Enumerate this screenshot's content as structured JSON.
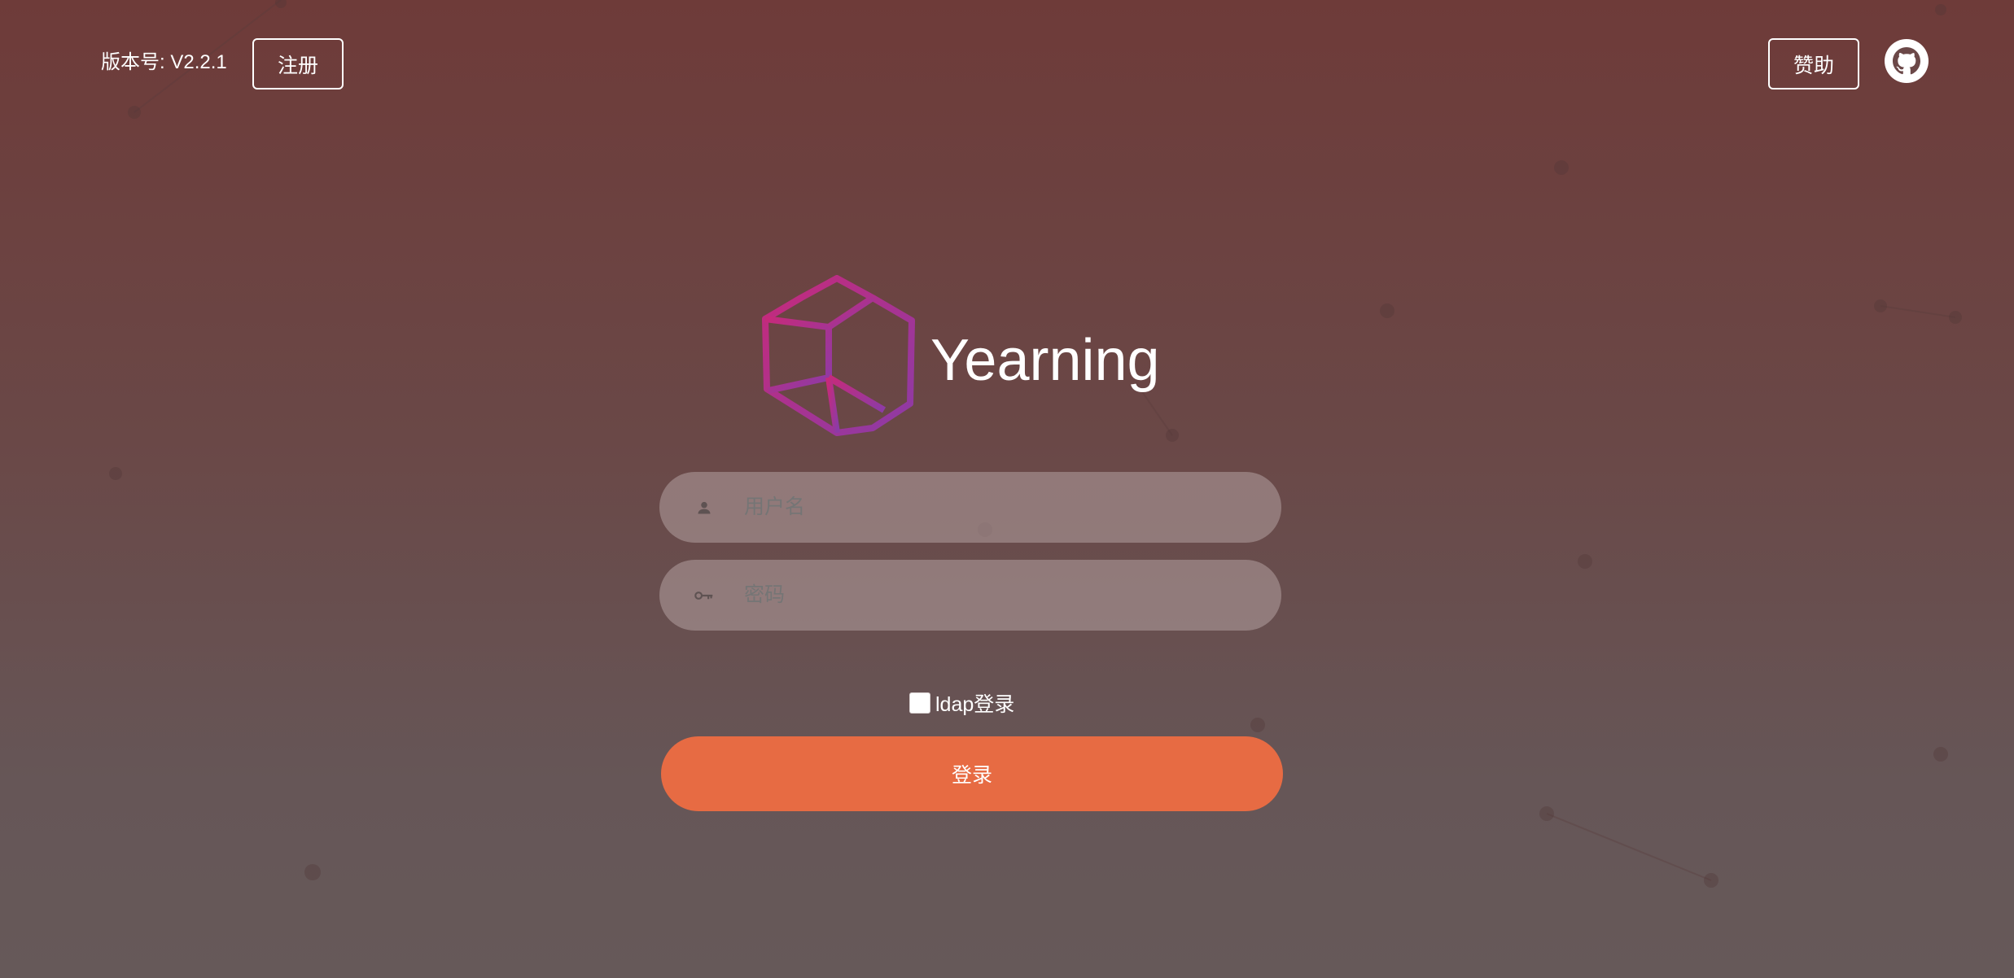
{
  "header": {
    "version_text": "版本号: V2.2.1",
    "register_label": "注册",
    "sponsor_label": "赞助",
    "github_icon": "github-icon"
  },
  "brand": {
    "name": "Yearning",
    "logo_icon": "hexagon-cube-logo",
    "logo_colors": [
      "#c0297f",
      "#8a3aa8"
    ]
  },
  "form": {
    "username": {
      "placeholder": "用户名",
      "icon": "user-icon"
    },
    "password": {
      "placeholder": "密码",
      "icon": "key-icon"
    },
    "ldap_label": "ldap登录",
    "ldap_checked": false,
    "login_label": "登录"
  },
  "colors": {
    "accent": "#e76b43",
    "background_top": "#6e3b39",
    "background_bottom": "#665959"
  }
}
